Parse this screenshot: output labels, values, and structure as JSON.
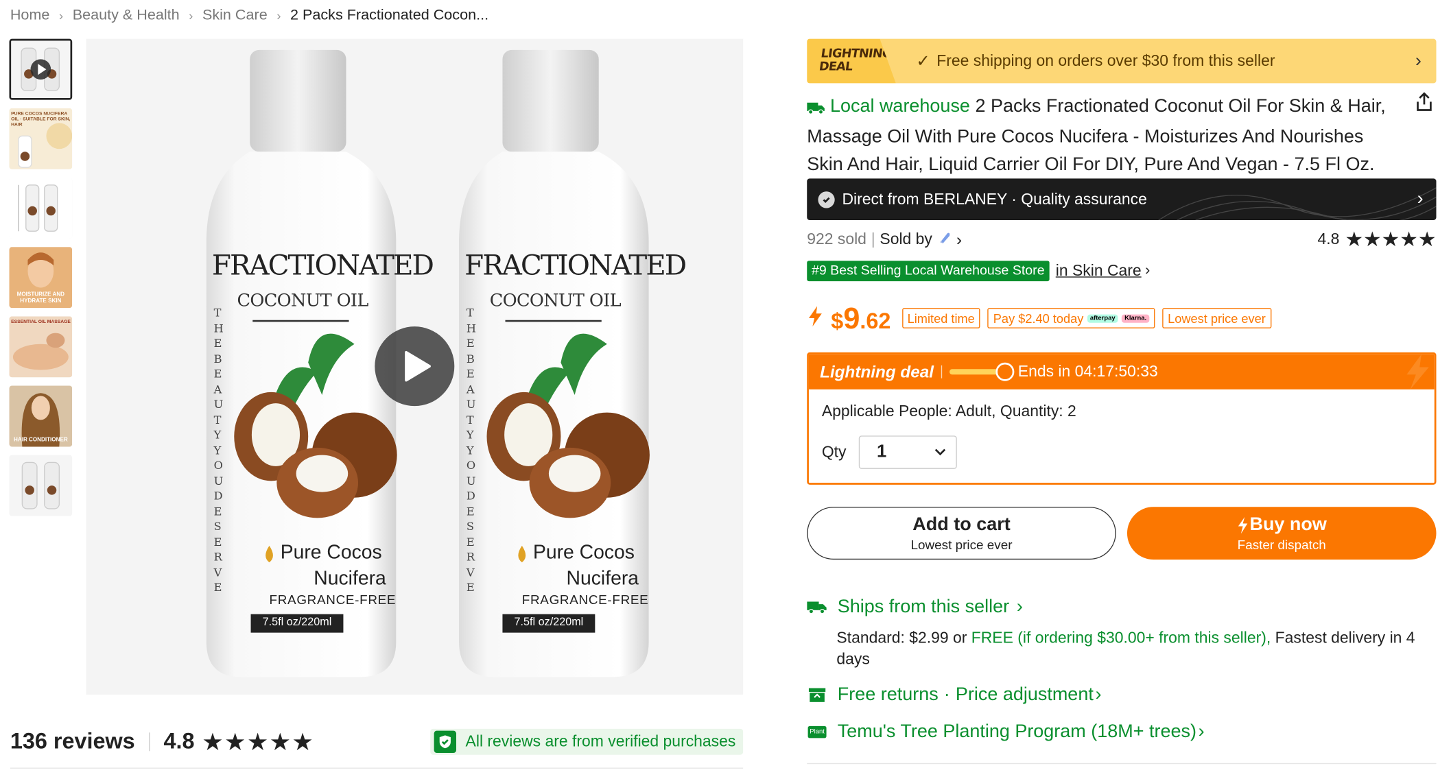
{
  "breadcrumb": {
    "items": [
      "Home",
      "Beauty & Health",
      "Skin Care"
    ],
    "current": "2 Packs Fractionated Cocon..."
  },
  "thumbnails": [
    {
      "name": "video-thumbnail",
      "caption": ""
    },
    {
      "name": "suitable-for-skin-hair",
      "caption": "PURE COCOS NUCIFERA OIL · SUITABLE FOR SKIN, HAIR"
    },
    {
      "name": "dimensions",
      "caption": ""
    },
    {
      "name": "moisturize",
      "caption": "MOISTURIZE AND HYDRATE SKIN"
    },
    {
      "name": "massage",
      "caption": "ESSENTIAL OIL MASSAGE"
    },
    {
      "name": "hair-conditioner",
      "caption": "HAIR CONDITIONER"
    },
    {
      "name": "pack-of-two",
      "caption": ""
    }
  ],
  "product_label": {
    "title": "FRACTIONATED",
    "subtitle": "COCONUT OIL",
    "vertical": "THE BEAUTY YOU DESERVE",
    "line1": "Pure Cocos",
    "line2": "Nucifera",
    "line3": "FRAGRANCE-FREE",
    "volume": "7.5fl oz/220ml"
  },
  "reviews": {
    "count": "136 reviews",
    "rating": "4.8",
    "stars": "★★★★★",
    "verified": "All reviews are from verified purchases"
  },
  "lightning": {
    "badge_line1": "LIGHTNING",
    "badge_line2": "DEAL",
    "check": "✓",
    "shipping": "Free shipping on orders over $30 from this seller"
  },
  "title": {
    "local": "Local warehouse",
    "text": "2 Packs Fractionated Coconut Oil For Skin & Hair, Massage Oil With Pure Cocos Nucifera - Moisturizes And Nourishes Skin And Hair, Liquid Carrier Oil For DIY, Pure And Vegan - 7.5 Fl Oz."
  },
  "direct": {
    "text": "Direct from BERLANEY · Quality assurance"
  },
  "sales": {
    "sold": "922 sold",
    "sold_by": "Sold by",
    "rating": "4.8",
    "stars": "★★★★★"
  },
  "best": {
    "badge": "#9 Best Selling Local Warehouse Store",
    "link": "in Skin Care"
  },
  "price": {
    "currency": "$",
    "integer": "9",
    "decimal": ".62",
    "tags": {
      "limited": "Limited time",
      "pay_today": "Pay $2.40 today",
      "afterpay": "afterpay",
      "klarna": "Klarna.",
      "lowest": "Lowest price ever"
    }
  },
  "deal": {
    "label": "Lightning deal",
    "ends": "Ends in 04:17:50:33",
    "applicable": "Applicable People: Adult, Quantity: 2",
    "qty_label": "Qty",
    "qty_value": "1"
  },
  "actions": {
    "add_cart": "Add to cart",
    "add_cart_sub": "Lowest price ever",
    "buy_now": "Buy now",
    "buy_now_sub": "Faster dispatch"
  },
  "shipping": {
    "ships_from": "Ships from this seller",
    "standard_prefix": "Standard: $2.99 or ",
    "standard_free": "FREE (if ordering $30.00+ from this seller),",
    "standard_suffix": " Fastest delivery in 4 days",
    "free_returns": "Free returns",
    "price_adjustment": "Price adjustment",
    "plant_badge": "Plant",
    "tree_program": "Temu's Tree Planting Program (18M+ trees)"
  },
  "colors": {
    "accent": "#fb7701",
    "green": "#0a8f2e",
    "lightning_bg": "#fdd776",
    "dark_bar": "#1c1c1c"
  }
}
